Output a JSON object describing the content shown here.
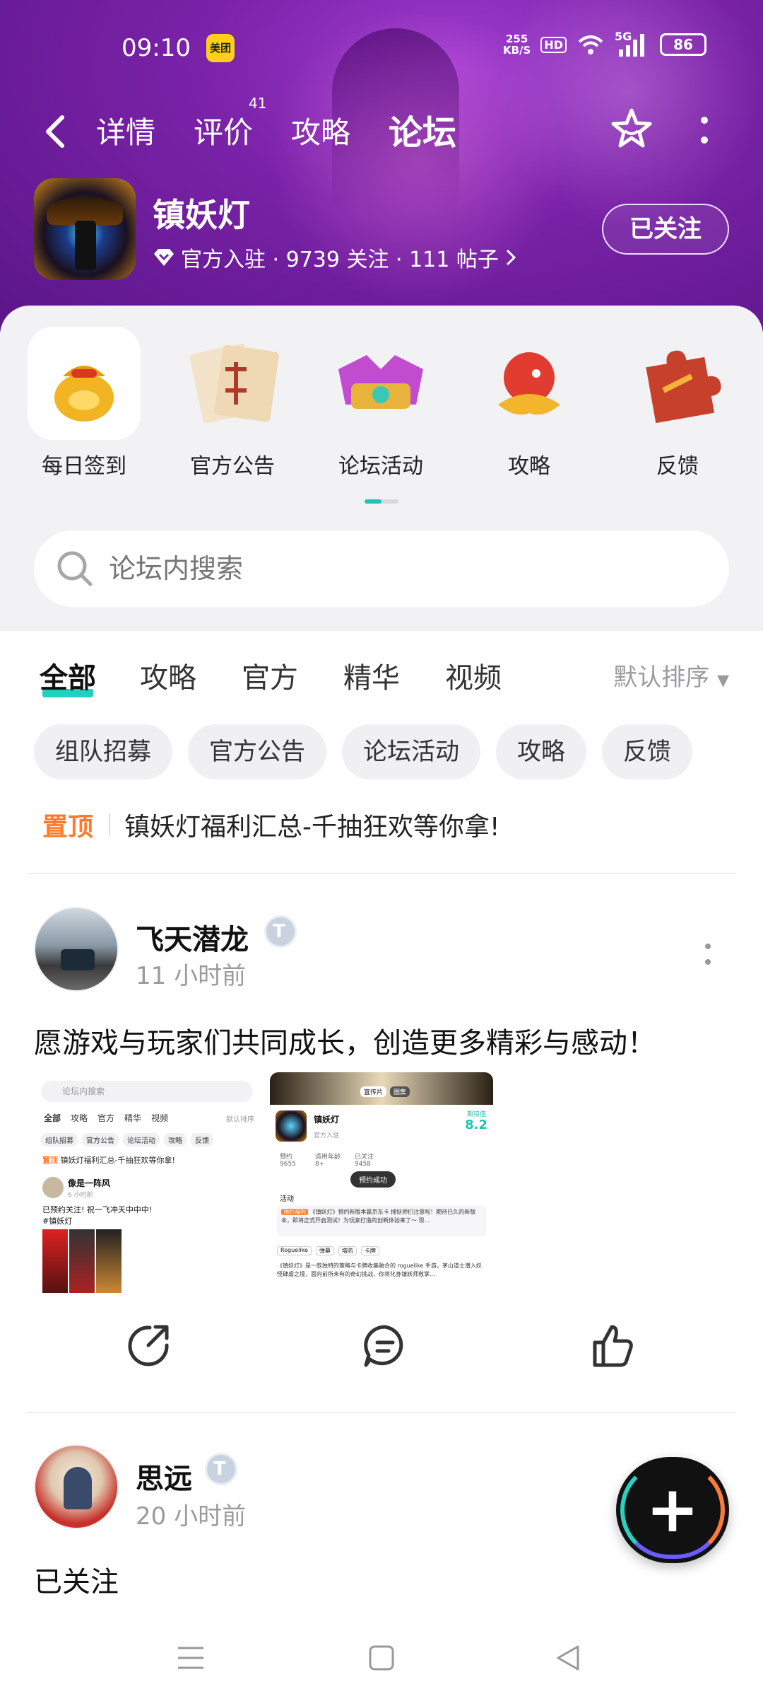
{
  "status": {
    "time": "09:10",
    "app_badge": "美团",
    "net_speed_top": "255",
    "net_speed_bottom": "KB/S",
    "hd": "HD",
    "network": "5G",
    "battery": "86"
  },
  "nav": {
    "tabs": [
      {
        "label": "详情"
      },
      {
        "label": "评价",
        "badge": "41"
      },
      {
        "label": "攻略"
      },
      {
        "label": "论坛"
      }
    ],
    "active_tab": "论坛"
  },
  "game": {
    "name": "镇妖灯",
    "meta": "官方入驻 · 9739 关注 · 111 帖子",
    "follow_label": "已关注"
  },
  "shortcuts": [
    {
      "label": "每日签到",
      "icon": "lucky-bag-icon"
    },
    {
      "label": "官方公告",
      "icon": "scroll-icon"
    },
    {
      "label": "论坛活动",
      "icon": "treasure-box-icon"
    },
    {
      "label": "攻略",
      "icon": "dragon-icon"
    },
    {
      "label": "反馈",
      "icon": "puzzle-icon"
    }
  ],
  "search": {
    "placeholder": "论坛内搜索"
  },
  "filter_tabs": [
    "全部",
    "攻略",
    "官方",
    "精华",
    "视频"
  ],
  "sort_label": "默认排序",
  "chips": [
    "组队招募",
    "官方公告",
    "论坛活动",
    "攻略",
    "反馈"
  ],
  "pinned": {
    "tag": "置顶",
    "title": "镇妖灯福利汇总-千抽狂欢等你拿!"
  },
  "posts": [
    {
      "author": "飞天潜龙",
      "time": "11 小时前",
      "text": "愿游戏与玩家们共同成长，创造更多精彩与感动！",
      "shot1": {
        "search": "论坛内搜索",
        "tabs": [
          "全部",
          "攻略",
          "官方",
          "精华",
          "视频"
        ],
        "sort": "默认排序",
        "chips": [
          "组队招募",
          "官方公告",
          "论坛活动",
          "攻略",
          "反馈"
        ],
        "pin_tag": "置顶",
        "pin": "镇妖灯福利汇总-千抽狂欢等你拿!",
        "author": "像是一阵风",
        "time": "6 小时前",
        "text1": "已预约关注! 祝一飞冲天中中中!",
        "text2": "#镇妖灯"
      },
      "shot2": {
        "tag1": "宣传片",
        "tag2": "图集",
        "name": "镇妖灯",
        "official": "官方入驻",
        "score_label": "期待值",
        "score": "8.2",
        "stat1_label": "预约",
        "stat1": "9655",
        "stat2_label": "适用年龄",
        "stat2": "8+",
        "stat3_label": "已关注",
        "stat3": "9458",
        "toast": "预约成功",
        "activity": "活动",
        "event_tag": "预约福利",
        "event_text": "《镇妖灯》预约新版本赢京东卡 搜妖师们注意啦！期待已久的新版本，即将正式开启测试！为玩家打造的创新体验来了～ 现...",
        "tags": [
          "Roguelike",
          "弹幕",
          "塔防",
          "卡牌"
        ],
        "desc": "《镇妖灯》是一款独特的策略与卡牌收集融合的 roguelike 手游，茅山道士潜入妖怪肆虐之境，面向前所未有的奇幻挑战，你将化身镇妖师救掌..."
      }
    },
    {
      "author": "思远",
      "time": "20 小时前",
      "text": "已关注"
    }
  ],
  "colors": {
    "accent": "#21d1c0",
    "pin": "#ff7a2a",
    "header": "#7a22a8"
  }
}
